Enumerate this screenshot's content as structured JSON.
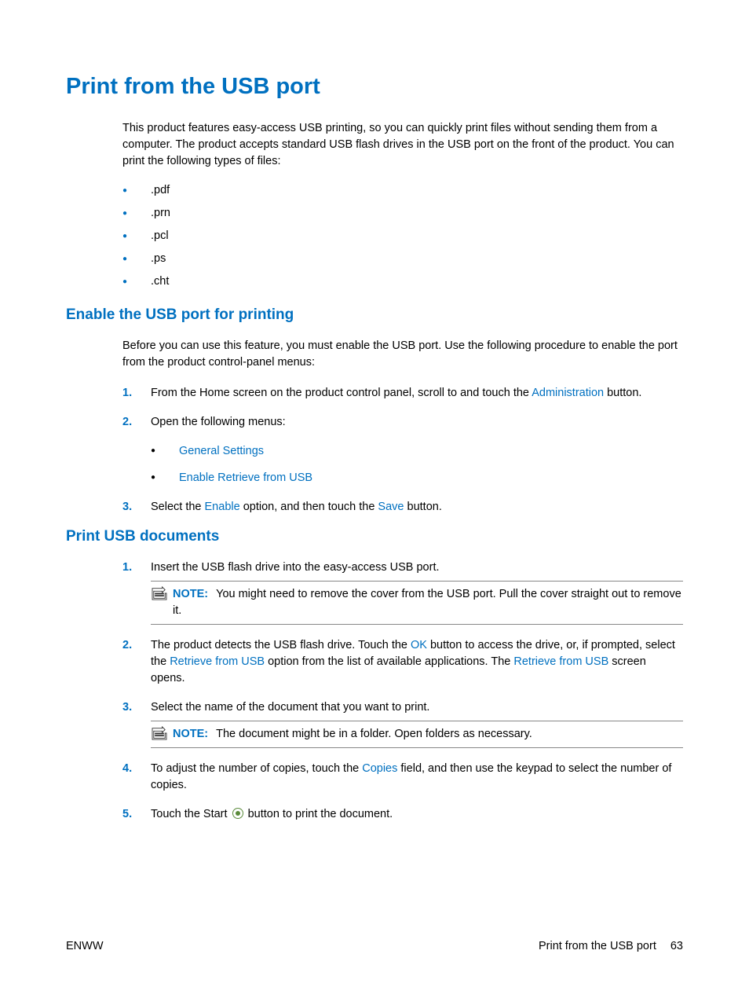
{
  "title": "Print from the USB port",
  "intro": "This product features easy-access USB printing, so you can quickly print files without sending them from a computer. The product accepts standard USB flash drives in the USB port on the front of the product. You can print the following types of files:",
  "file_types": [
    ".pdf",
    ".prn",
    ".pcl",
    ".ps",
    ".cht"
  ],
  "section1": {
    "heading": "Enable the USB port for printing",
    "intro": "Before you can use this feature, you must enable the USB port. Use the following procedure to enable the port from the product control-panel menus:",
    "steps": {
      "s1_prefix": "From the Home screen on the product control panel, scroll to and touch the ",
      "s1_link": "Administration",
      "s1_suffix": " button.",
      "s2_text": "Open the following menus:",
      "s2_items": [
        "General Settings",
        "Enable Retrieve from USB"
      ],
      "s3_prefix": "Select the ",
      "s3_link1": "Enable",
      "s3_mid": " option, and then touch the ",
      "s3_link2": "Save",
      "s3_suffix": " button."
    }
  },
  "section2": {
    "heading": "Print USB documents",
    "s1": "Insert the USB flash drive into the easy-access USB port.",
    "note1_label": "NOTE:",
    "note1_text": "You might need to remove the cover from the USB port. Pull the cover straight out to remove it.",
    "s2_prefix": "The product detects the USB flash drive. Touch the ",
    "s2_link1": "OK",
    "s2_mid1": " button to access the drive, or, if prompted, select the ",
    "s2_link2": "Retrieve from USB",
    "s2_mid2": " option from the list of available applications. The ",
    "s2_link3": "Retrieve from USB",
    "s2_suffix": " screen opens.",
    "s3": "Select the name of the document that you want to print.",
    "note2_label": "NOTE:",
    "note2_text": "The document might be in a folder. Open folders as necessary.",
    "s4_prefix": "To adjust the number of copies, touch the ",
    "s4_link": "Copies",
    "s4_suffix": " field, and then use the keypad to select the number of copies.",
    "s5_prefix": "Touch the Start ",
    "s5_suffix": " button to print the document."
  },
  "footer": {
    "left": "ENWW",
    "right_text": "Print from the USB port",
    "page": "63"
  }
}
